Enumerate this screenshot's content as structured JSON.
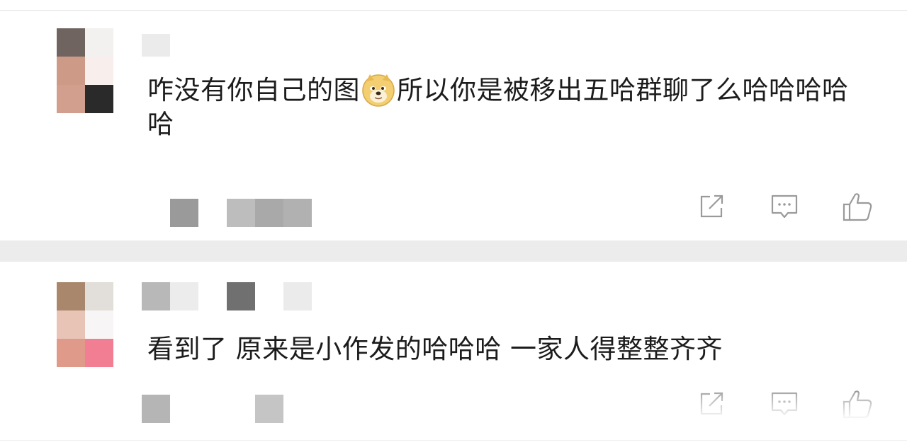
{
  "comments": [
    {
      "text_before_emoji": "咋没有你自己的图",
      "emoji": "doge-emoji",
      "text_after_emoji": "所以你是被移出五哈群聊了么哈哈哈哈哈",
      "actions": [
        "share-icon",
        "comment-icon",
        "like-icon"
      ]
    },
    {
      "text": "看到了 原来是小作发的哈哈哈 一家人得整整齐齐",
      "actions": [
        "share-icon",
        "comment-icon",
        "like-icon"
      ]
    }
  ],
  "colors": {
    "divider": "#ececec",
    "icon": "#9a9a9a",
    "text": "#1c1c1c",
    "emoji_face": "#f3cf72"
  }
}
